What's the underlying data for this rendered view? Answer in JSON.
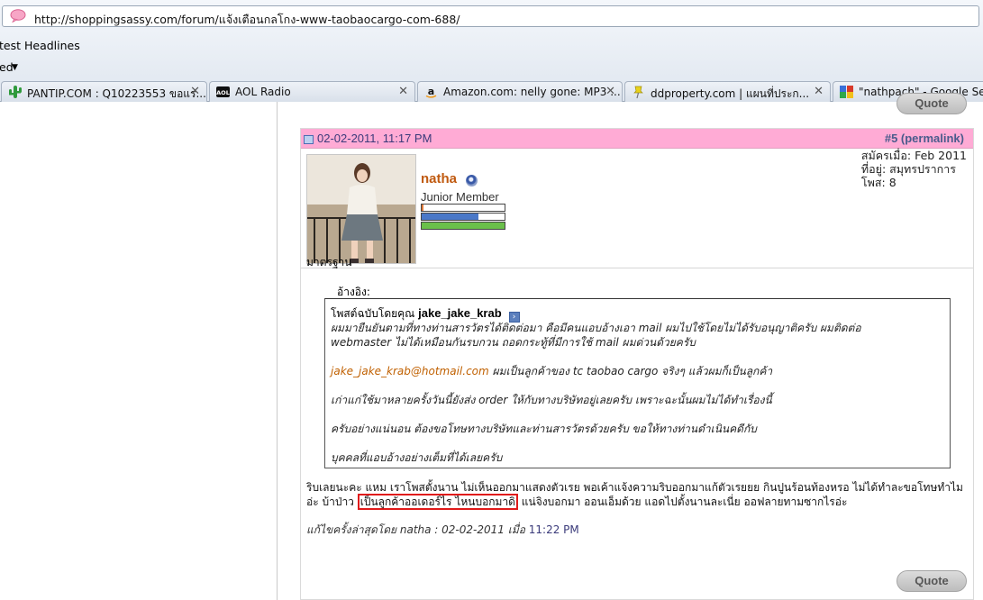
{
  "browser": {
    "address": "http://shoppingsassy.com/forum/แจ้งเตือนกลโกง-www-taobaocargo-com-688/",
    "bookmarks_row1": "test Headlines",
    "bookmarks_row2": "ed",
    "tabs": [
      {
        "label": "PANTIP.COM : Q10223553 ขอแร...",
        "icon": "cactus-icon"
      },
      {
        "label": "AOL Radio",
        "icon": "aol-icon"
      },
      {
        "label": "Amazon.com: nelly gone: MP3 ...",
        "icon": "amazon-icon"
      },
      {
        "label": "ddproperty.com | แผนที่ประก...",
        "icon": "pin-icon"
      },
      {
        "label": "\"nathpach\" - Google Search",
        "icon": "google-icon"
      }
    ]
  },
  "quote_button_label": "Quote",
  "post": {
    "date": "02-02-2011, 11:17 PM",
    "number": "#5 (permalink)",
    "username": "natha",
    "rank": "Junior Member",
    "joined": "สมัครเมื่อ: Feb 2011",
    "location": "ที่อยู่: สมุทรปราการ",
    "posts": "โพส: 8",
    "reputation_bars": [
      0.02,
      0.68,
      1.0
    ],
    "first_line": "มาตรฐาน",
    "quote_label": "อ้างอิง:",
    "quote": {
      "author_prefix": "โพสต์ฉบับโดยคุณ",
      "author": "jake_jake_krab",
      "line1": "ผมมายืนยันตามที่ทางท่านสารวัตรได้ติดต่อมา คือมีคนแอบอ้างเอา mail ผมไปใช้โดยไม่ได้รับอนุญาติครับ ผมติดต่อ",
      "line2": "webmaster  ไม่ได้เหมือนกันรบกวน ถอดกระทู้ที่มีการใช้ mail ผมด่วนด้วยครับ",
      "email": "jake_jake_krab@hotmail.com",
      "line3_rest": " ผมเป็นลูกค้าของ tc taobao cargo  จริงๆ แล้วผมก็เป็นลูกค้า",
      "line4": "เก่าแก่ใช้มาหลายครั้งวันนี้ยังส่ง order  ให้กับทางบริษัทอยู่เลยครับ  เพราะฉะนั้นผมไม่ได้ทำเรื่องนี้",
      "line5": "ครับอย่างแน่นอน  ต้องขอโทษทางบริษัทและท่านสารวัตรด้วยครับ  ขอให้ทางท่านดำเนินคดีกับ",
      "line6": "บุคคลที่แอบอ้างอย่างเต็มที่ได้เลยครับ"
    },
    "reply_part1": "ริบเลยนะคะ แหม เราโพสตั้งนาน ไม่เห็นออกมาแสดงตัวเรย พอเค้าแจ้งความริบออกมาแก้ตัวเรยยย กินปูนร้อนท้องหรอ ไม่ได้ทำละขอโทษทำไมอ่ะ บ้าป่าว ",
    "reply_highlight": "เป็นลูกค้าออเดอร์ไร ไหนบอกมาดิ",
    "reply_part2": " แน่จิงบอกมา ออนเอ็มด้วย แอดไปตั้งนานละเนี่ย ออฟลายทามซากไรอ่ะ",
    "edit_prefix": "แก้ไขครั้งล่าสุดโดย natha : 02-02-2011 เมื่อ ",
    "edit_time": "11:22 PM"
  },
  "colors": {
    "header_pink": "#ffabd5",
    "username": "#c05a10",
    "bar1": "#e07a3a",
    "bar2": "#4a78c8",
    "bar3": "#6ac04a",
    "highlight_border": "#e01a1a"
  }
}
